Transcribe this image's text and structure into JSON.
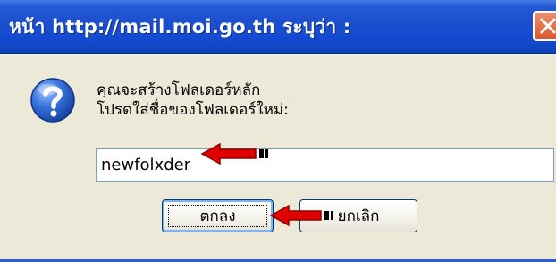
{
  "window": {
    "title": "หน้า http://mail.moi.go.th ระบุว่า :",
    "close_icon": "close-x-icon"
  },
  "dialog": {
    "icon": "question-icon",
    "message_line1": "คุณจะสร้างโฟลเดอร์หลัก",
    "message_line2": "โปรดใส่ชื่อของโฟลเดอร์ใหม่:",
    "input_value": "newfolxder",
    "ok_label": "ตกลง",
    "cancel_label": "ยกเลิก"
  },
  "annotations": {
    "arrow_color": "#e00000"
  },
  "colors": {
    "titlebar": "#1f4fcf",
    "body": "#ece9d8",
    "close_button": "#d8582b"
  }
}
